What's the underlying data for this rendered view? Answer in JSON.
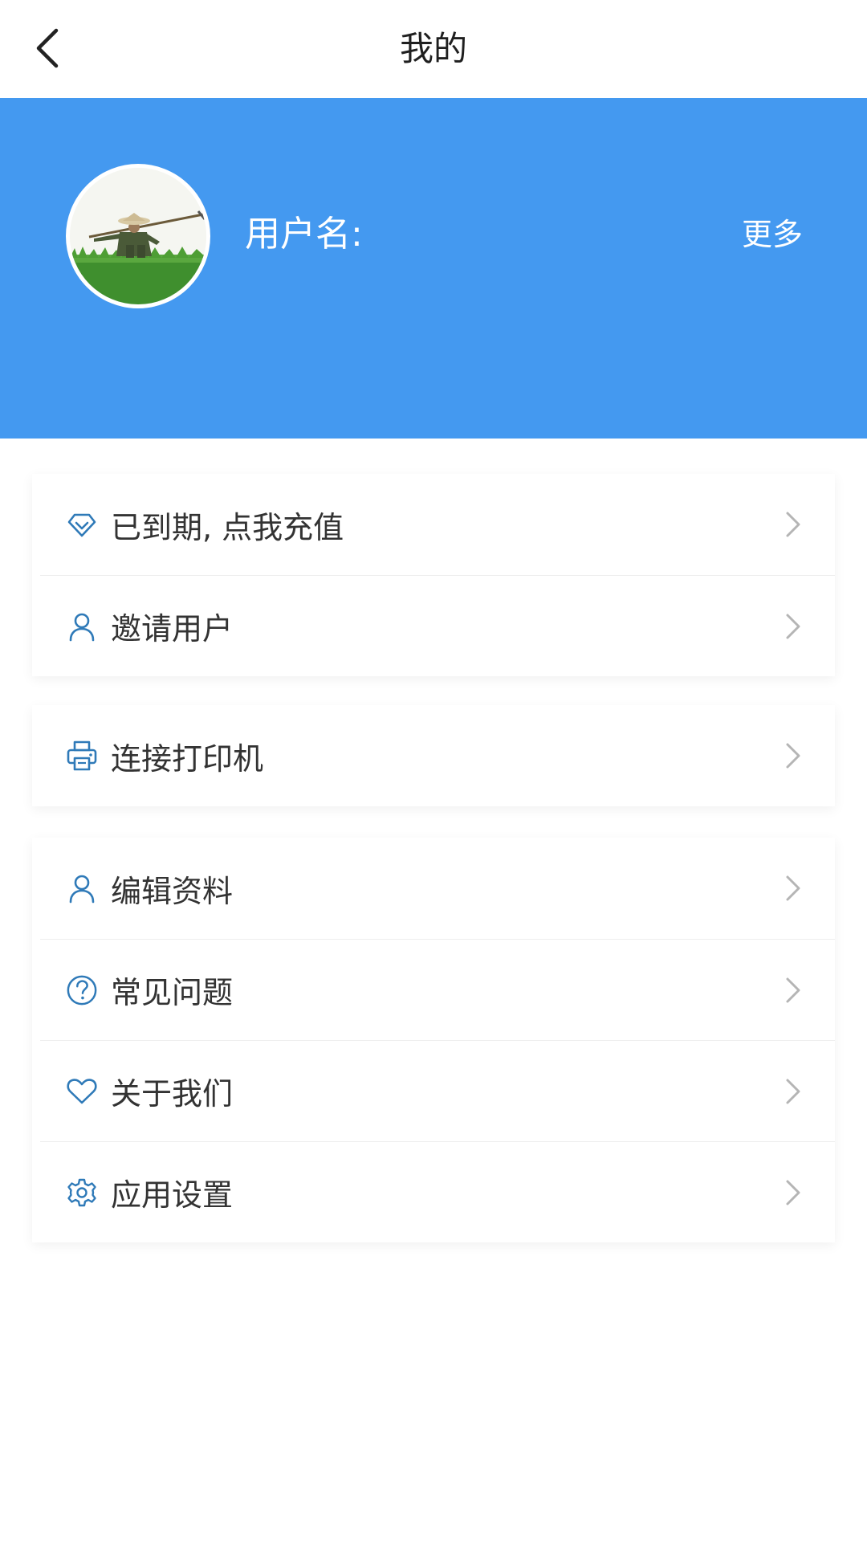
{
  "header": {
    "title": "我的",
    "back_icon": "chevron-left-icon"
  },
  "profile": {
    "username_label": "用户名:",
    "more_label": "更多",
    "avatar": "farmer-photo-avatar"
  },
  "menu_groups": [
    {
      "items": [
        {
          "label": "已到期, 点我充值",
          "icon": "diamond-icon"
        },
        {
          "label": "邀请用户",
          "icon": "user-icon"
        }
      ]
    },
    {
      "items": [
        {
          "label": "连接打印机",
          "icon": "printer-icon"
        }
      ]
    },
    {
      "items": [
        {
          "label": "编辑资料",
          "icon": "user-icon"
        },
        {
          "label": "常见问题",
          "icon": "question-circle-icon"
        },
        {
          "label": "关于我们",
          "icon": "heart-icon"
        },
        {
          "label": "应用设置",
          "icon": "gear-icon"
        }
      ]
    }
  ],
  "colors": {
    "accent": "#4499f0",
    "icon": "#2f7ab8",
    "chevron": "#b5b5b5",
    "text": "#333333"
  }
}
